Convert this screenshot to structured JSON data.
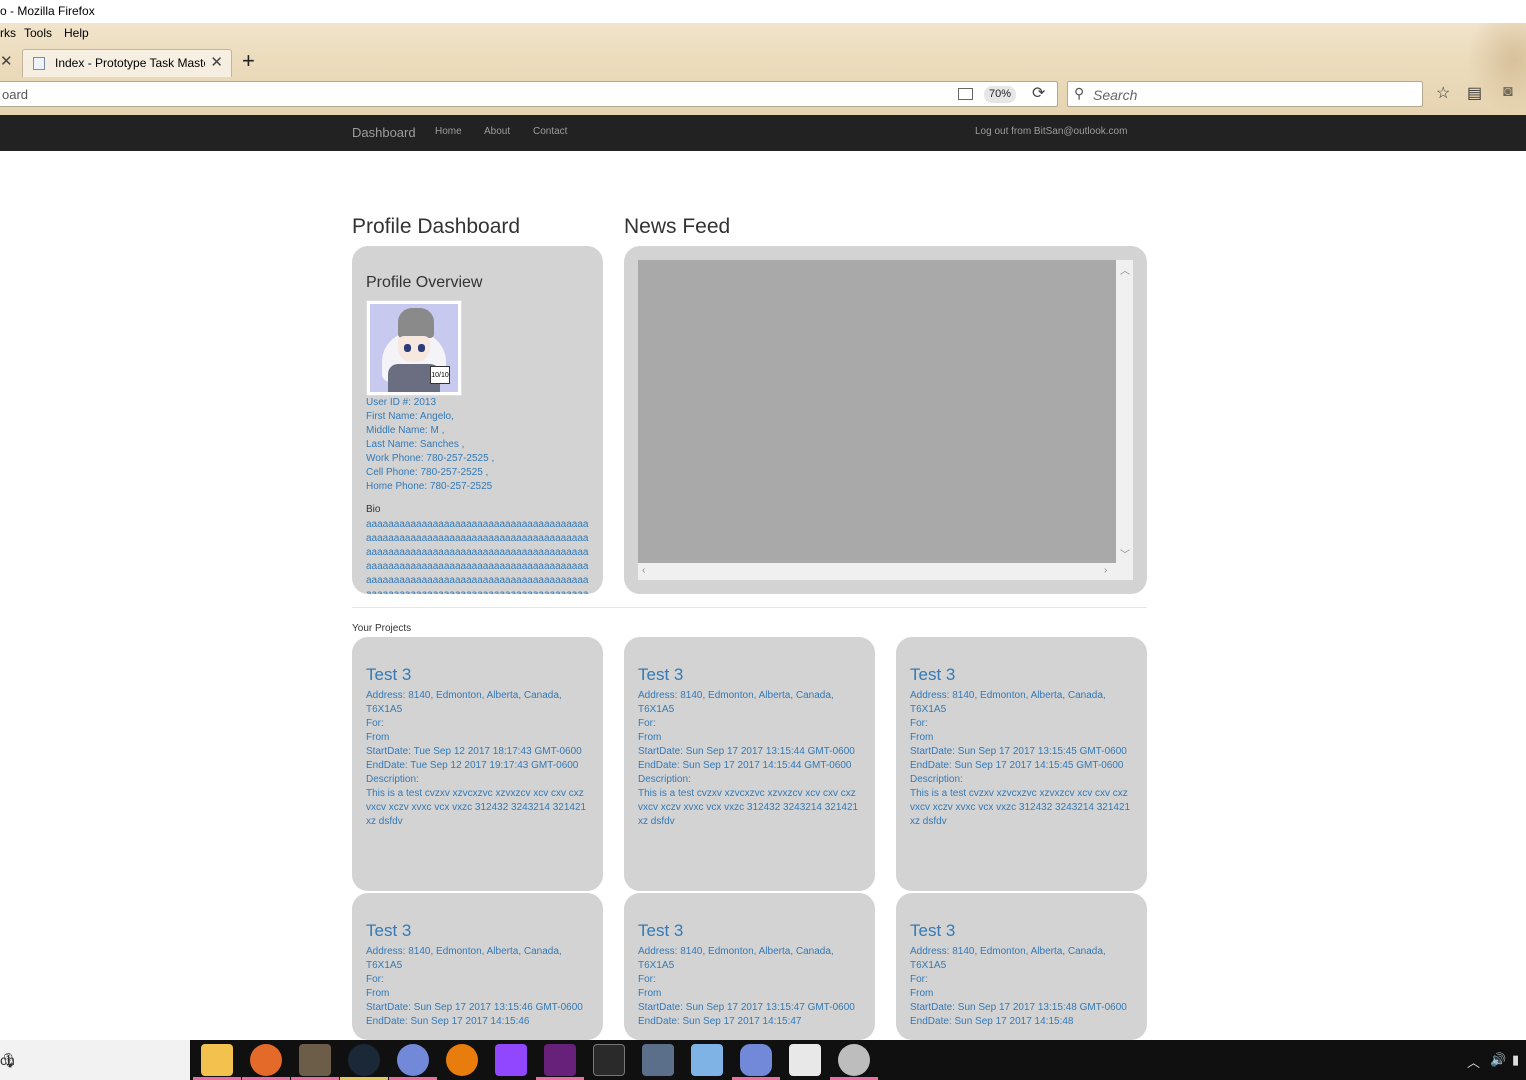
{
  "window": {
    "title": "o - Mozilla Firefox"
  },
  "menubar": {
    "items": [
      "rks",
      "Tools",
      "Help"
    ]
  },
  "tab": {
    "title": "Index - Prototype Task Maste",
    "close": "✕"
  },
  "urlbar": {
    "url": "oard",
    "zoom": "70%"
  },
  "searchbar": {
    "placeholder": "Search"
  },
  "navbar": {
    "brand": "Dashboard",
    "links": [
      "Home",
      "About",
      "Contact"
    ],
    "logout": "Log out from BitSan@outlook.com"
  },
  "profile": {
    "heading": "Profile Dashboard",
    "panel_title": "Profile Overview",
    "avatar_badge": "10/10",
    "fields": [
      "User ID #: 2013",
      "First Name: Angelo,",
      "Middle Name: M ,",
      "Last Name: Sanches ,",
      "Work Phone: 780-257-2525 ,",
      "Cell Phone: 780-257-2525 ,",
      "Home Phone: 780-257-2525"
    ],
    "bio_label": "Bio",
    "bio_text": "aaaaaaaaaaaaaaaaaaaaaaaaaaaaaaaaaaaaaaaaaaaaaaaaaaaaaaaaaaaaaaaaaaaaaaaaaaaaaaaaaaaaaaaaaaaaaaaaaaaaaaaaaaaaaaaaaaaaaaaaaaaaaaaaaaaaaaaaaaaaaaaaaaaaaaaaaaaaaaaaaaaaaaaaaaaaaaaaaaaaaaaaaaaaaaaaaaaaaaaaaaaaaaaaaaaaaaaaaaaaaaaaaaaaaaaaaaaaaaaaaaaaaaaaaaaaaaaaaaaaaaaaaaaaaaaaaaaaaaaaaaaaaaaaaaaaaaaaaaaaaaaaaaaaaaaaaaaaaaaaaaaaaaaaaaaaaaaaaaaaaaaaaaaa"
  },
  "news": {
    "heading": "News Feed"
  },
  "projects": {
    "label": "Your Projects",
    "cards": [
      {
        "title": "Test 3",
        "address": "Address: 8140, Edmonton, Alberta, Canada, T6X1A5",
        "for": "For:",
        "from": "From",
        "start": "StartDate: Tue Sep 12 2017 18:17:43 GMT-0600",
        "end": "EndDate: Tue Sep 12 2017 19:17:43 GMT-0600",
        "desc_label": "Description:",
        "desc": "This is a test cvzxv xzvcxzvc xzvxzcv xcv cxv cxz vxcv xczv xvxc vcx vxzc 312432 3243214 321421 xz dsfdv"
      },
      {
        "title": "Test 3",
        "address": "Address: 8140, Edmonton, Alberta, Canada, T6X1A5",
        "for": "For:",
        "from": "From",
        "start": "StartDate: Sun Sep 17 2017 13:15:44 GMT-0600",
        "end": "EndDate: Sun Sep 17 2017 14:15:44 GMT-0600",
        "desc_label": "Description:",
        "desc": "This is a test cvzxv xzvcxzvc xzvxzcv xcv cxv cxz vxcv xczv xvxc vcx vxzc 312432 3243214 321421 xz dsfdv"
      },
      {
        "title": "Test 3",
        "address": "Address: 8140, Edmonton, Alberta, Canada, T6X1A5",
        "for": "For:",
        "from": "From",
        "start": "StartDate: Sun Sep 17 2017 13:15:45 GMT-0600",
        "end": "EndDate: Sun Sep 17 2017 14:15:45 GMT-0600",
        "desc_label": "Description:",
        "desc": "This is a test cvzxv xzvcxzvc xzvxzcv xcv cxv cxz vxcv xczv xvxc vcx vxzc 312432 3243214 321421 xz dsfdv"
      },
      {
        "title": "Test 3",
        "address": "Address: 8140, Edmonton, Alberta, Canada, T6X1A5",
        "for": "For:",
        "from": "From",
        "start": "StartDate: Sun Sep 17 2017 13:15:46 GMT-0600",
        "end": "EndDate: Sun Sep 17 2017 14:15:46",
        "desc_label": "",
        "desc": ""
      },
      {
        "title": "Test 3",
        "address": "Address: 8140, Edmonton, Alberta, Canada, T6X1A5",
        "for": "For:",
        "from": "From",
        "start": "StartDate: Sun Sep 17 2017 13:15:47 GMT-0600",
        "end": "EndDate: Sun Sep 17 2017 14:15:47",
        "desc_label": "",
        "desc": ""
      },
      {
        "title": "Test 3",
        "address": "Address: 8140, Edmonton, Alberta, Canada, T6X1A5",
        "for": "For:",
        "from": "From",
        "start": "StartDate: Sun Sep 17 2017 13:15:48 GMT-0600",
        "end": "EndDate: Sun Sep 17 2017 14:15:48",
        "desc_label": "",
        "desc": ""
      }
    ]
  },
  "taskbar": {
    "search_text": "ch",
    "apps": [
      "file-explorer",
      "firefox",
      "gimp",
      "steam",
      "discord-app",
      "blender",
      "twitch",
      "visual-studio",
      "epic-games",
      "snipping-tool",
      "virtualbox",
      "discord",
      "mail",
      "obs"
    ]
  },
  "colors": {
    "navbar": "#222222",
    "panel": "#d3d3d3",
    "link": "#337ab7",
    "feed": "#a9a9a9",
    "taskbar": "#101010"
  }
}
